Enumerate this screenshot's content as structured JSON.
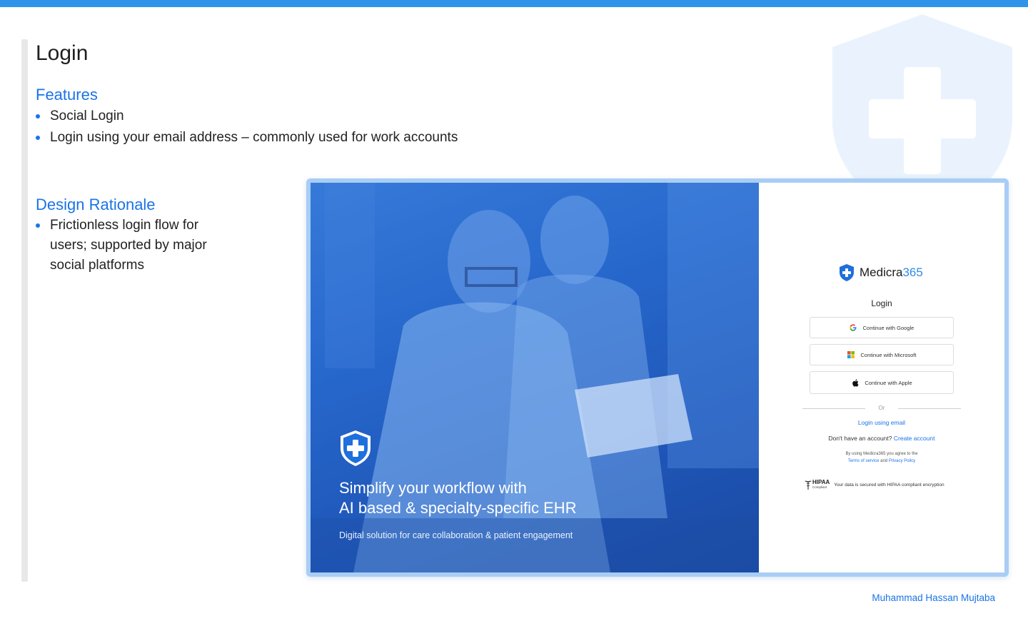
{
  "slide": {
    "title": "Login",
    "author": "Muhammad Hassan Mujtaba",
    "accent_color": "#1a73e8",
    "top_bar_color": "#2f93ea"
  },
  "features": {
    "heading": "Features",
    "items": [
      "Social Login",
      "Login using your email address – commonly used for work accounts"
    ]
  },
  "rationale": {
    "heading": "Design Rationale",
    "items": [
      "Frictionless login flow for users; supported by major social platforms"
    ]
  },
  "mockup": {
    "hero": {
      "headline_line1": "Simplify your workflow with",
      "headline_line2": "AI based & specialty-specific EHR",
      "subtext": "Digital solution for care collaboration & patient engagement",
      "shield_icon": "shield-plus-icon"
    },
    "login": {
      "brand_name": "Medicra",
      "brand_number": "365",
      "heading": "Login",
      "buttons": {
        "google": "Continue with Google",
        "microsoft": "Continue with Microsoft",
        "apple": "Continue with Apple"
      },
      "or_label": "Or",
      "email_link": "Login using email",
      "signup_prompt": "Don't have an account?",
      "signup_link": "Create account",
      "legal_prefix": "By using Medicra365 you agree to the",
      "terms_link": "Terms of service",
      "legal_and": "and",
      "privacy_link": "Privacy Policy",
      "hipaa_badge": "HIPAA",
      "hipaa_badge_small": "Compliant",
      "hipaa_text": "Your data is secured with HIPAA compliant encryption"
    }
  }
}
